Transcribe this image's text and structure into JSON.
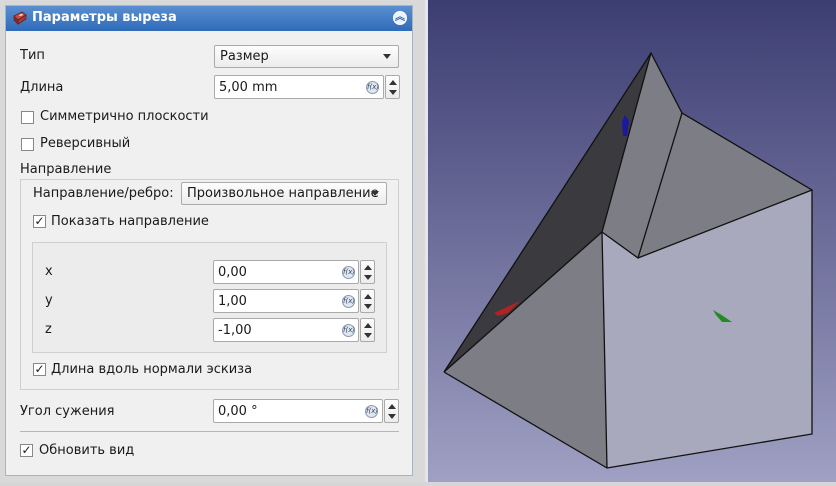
{
  "panel": {
    "title": "Параметры выреза",
    "type_label": "Тип",
    "type_value": "Размер",
    "length_label": "Длина",
    "length_value": "5,00 mm",
    "symmetric_label": "Симметрично плоскости",
    "symmetric_checked": false,
    "reversed_label": "Реверсивный",
    "reversed_checked": false,
    "direction_section": "Направление",
    "direction_edge_label": "Направление/ребро:",
    "direction_edge_value": "Произвольное направление",
    "show_direction_label": "Показать направление",
    "show_direction_checked": true,
    "x_label": "x",
    "x_value": "0,00",
    "y_label": "y",
    "y_value": "1,00",
    "z_label": "z",
    "z_value": "-1,00",
    "along_normal_label": "Длина вдоль нормали эскиза",
    "along_normal_checked": true,
    "taper_label": "Угол сужения",
    "taper_value": "0,00 °",
    "update_view_label": "Обновить вид",
    "update_view_checked": true,
    "fx_glyph": "f(x)",
    "check_glyph": "✓",
    "collapse_glyph": "︽"
  },
  "viewport": {
    "background_top": "#3c3d72",
    "background_bottom": "#9fa0c3",
    "face_light": "#a9a9bd",
    "face_mid": "#7d7d86",
    "face_dark": "#3a3a3f",
    "axis_x_color": "#b22222",
    "axis_y_color": "#228b22",
    "axis_z_color": "#1a1aa0"
  }
}
